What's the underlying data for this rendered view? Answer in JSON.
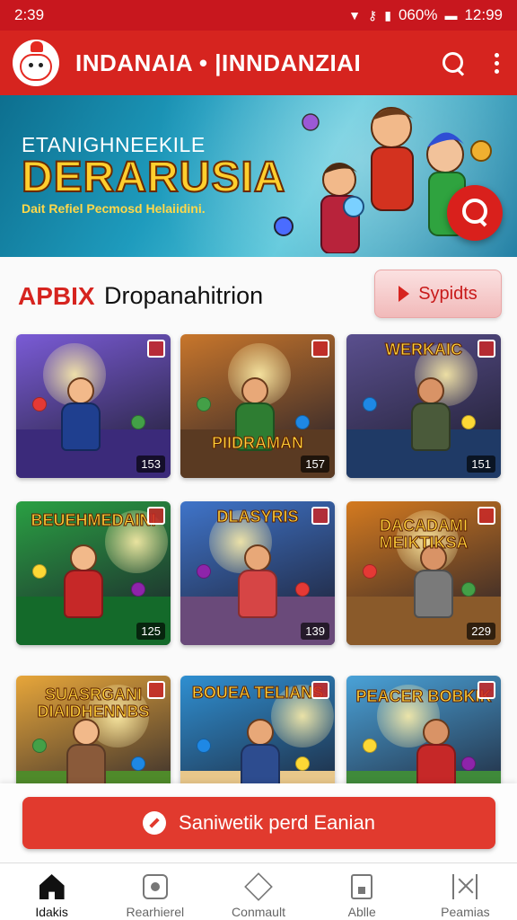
{
  "status_bar": {
    "time": "2:39",
    "battery": "060%",
    "clock": "12:99"
  },
  "header": {
    "title": "INDANAIA • |INNDANZIAI"
  },
  "hero": {
    "kicker": "ETANIGHNEEKILE",
    "title": "DERARUSIA",
    "subtitle": "Dait Refiel  Pecmosd Helaiidini."
  },
  "section": {
    "brand": "APBIX",
    "title": "Dropanahitrion",
    "button_label": "Sypidts"
  },
  "games": [
    {
      "title": "",
      "count": "153",
      "theme": "#7a5bd6"
    },
    {
      "title": "PIIDRAMAN",
      "count": "157",
      "theme": "#c8762b"
    },
    {
      "title": "WERKAIC",
      "count": "151",
      "theme": "#5a4f8e"
    },
    {
      "title": "BEUEHMEDAINI",
      "count": "125",
      "theme": "#2aa043"
    },
    {
      "title": "DLASYRIS",
      "count": "139",
      "theme": "#3f74c9"
    },
    {
      "title": "DACADAMI MEIKTIKSA",
      "count": "229",
      "theme": "#d47a1f"
    },
    {
      "title": "SUASRGANI DIAIDHENNBS",
      "count": "",
      "theme": "#e7a63a"
    },
    {
      "title": "BOUEA TELIANS",
      "count": "",
      "theme": "#2f8fd1"
    },
    {
      "title": "PEACER BOBKIK",
      "count": "",
      "theme": "#4aa2d8"
    }
  ],
  "cta": {
    "label": "Saniwetik perd Eanian"
  },
  "bottom_nav": [
    {
      "label": "Idakis",
      "icon": "home-icon",
      "active": true
    },
    {
      "label": "Rearhierel",
      "icon": "record-icon",
      "active": false
    },
    {
      "label": "Conmault",
      "icon": "diamond-icon",
      "active": false
    },
    {
      "label": "Ablle",
      "icon": "document-icon",
      "active": false
    },
    {
      "label": "Peamias",
      "icon": "ribbon-icon",
      "active": false
    }
  ],
  "colors": {
    "brand_red": "#d6241f",
    "status_red": "#c8171e",
    "cta_red": "#e13a2e"
  }
}
